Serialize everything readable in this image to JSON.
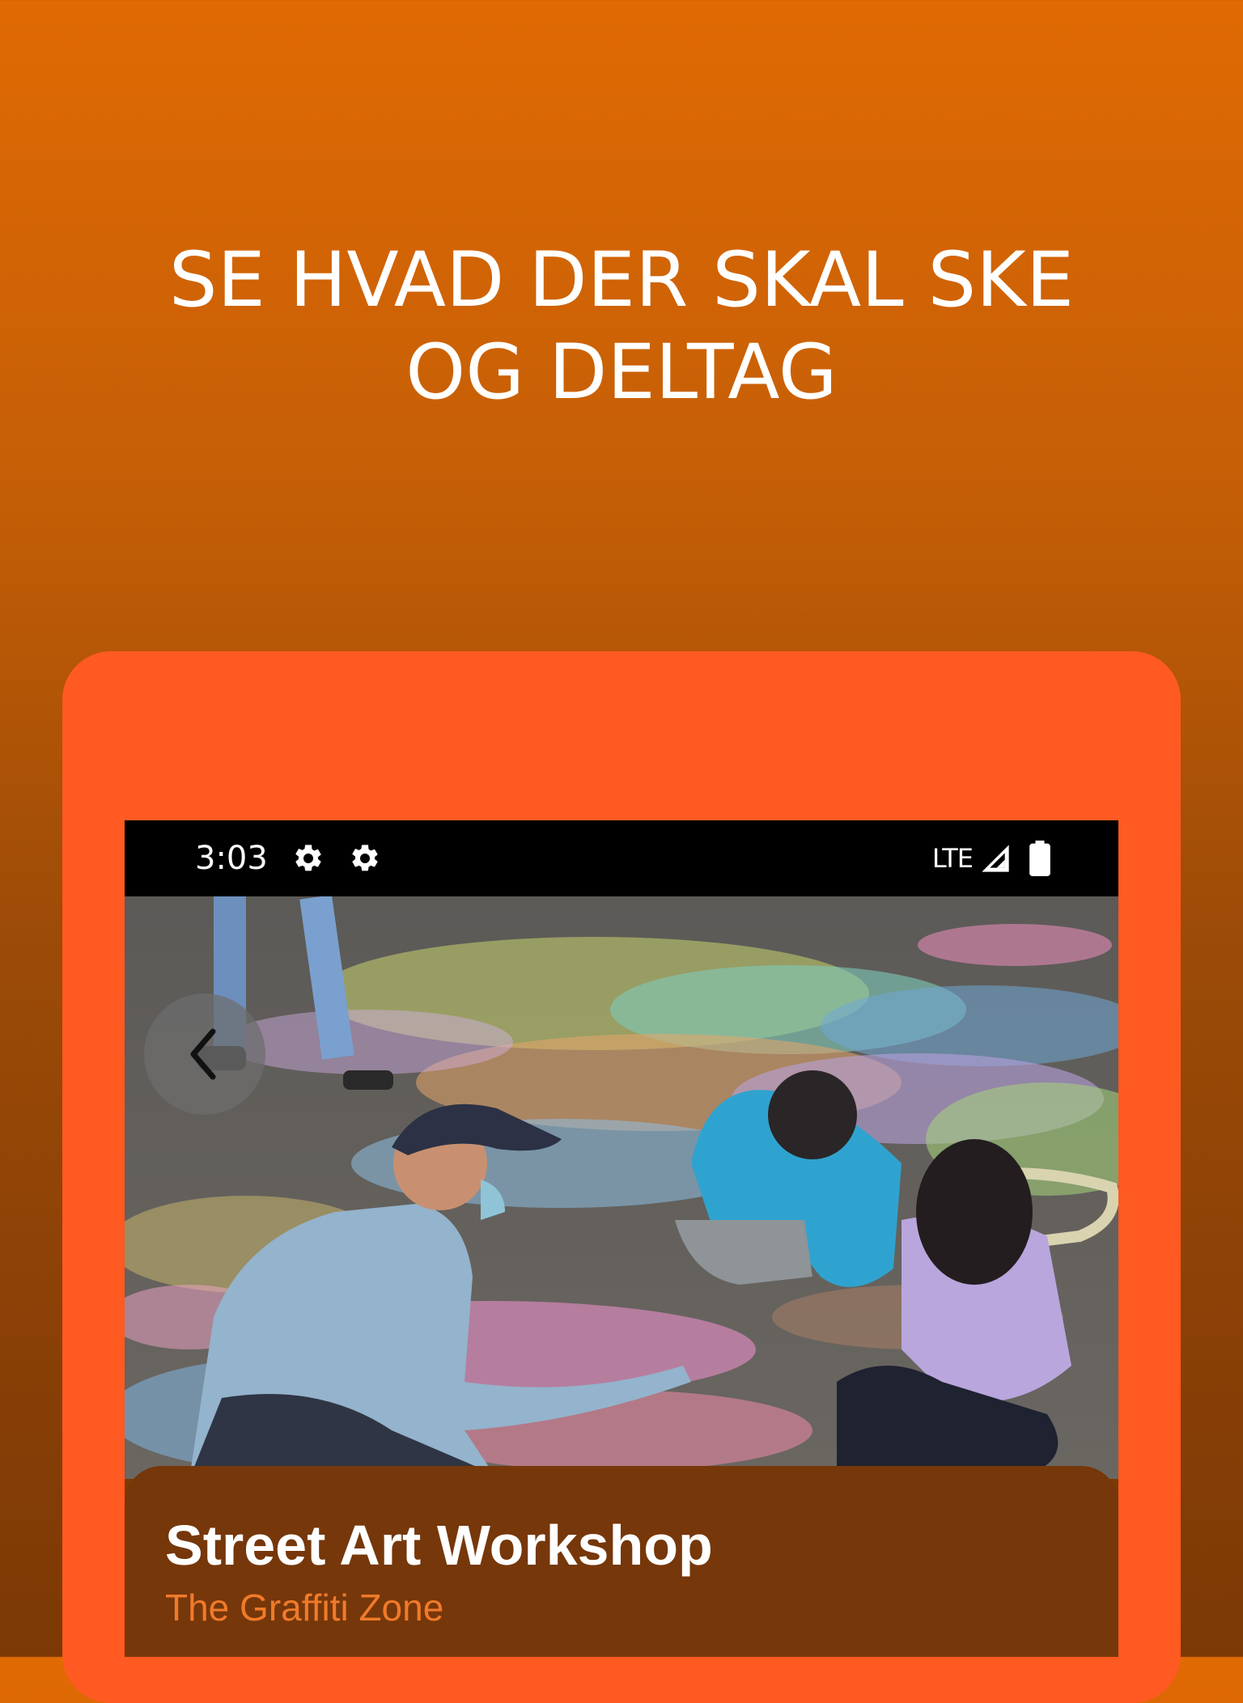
{
  "headline": {
    "line1": "SE HVAD DER SKAL SKE",
    "line2": "OG DELTAG"
  },
  "status_bar": {
    "time": "3:03",
    "icons": [
      "settings-icon",
      "settings-icon"
    ],
    "network": "LTE",
    "signal_icon": "cell-signal-icon",
    "battery_icon": "battery-icon"
  },
  "hero_image": {
    "description_icon": "photo",
    "back_icon": "chevron-left-icon"
  },
  "event": {
    "title": "Street Art Workshop",
    "venue": "The Graffiti Zone"
  },
  "colors": {
    "background_top": "#E06A04",
    "background_bottom": "#7C3905",
    "card": "#FF5A22",
    "panel": "#76370A",
    "venue_text": "#F07A2A"
  }
}
